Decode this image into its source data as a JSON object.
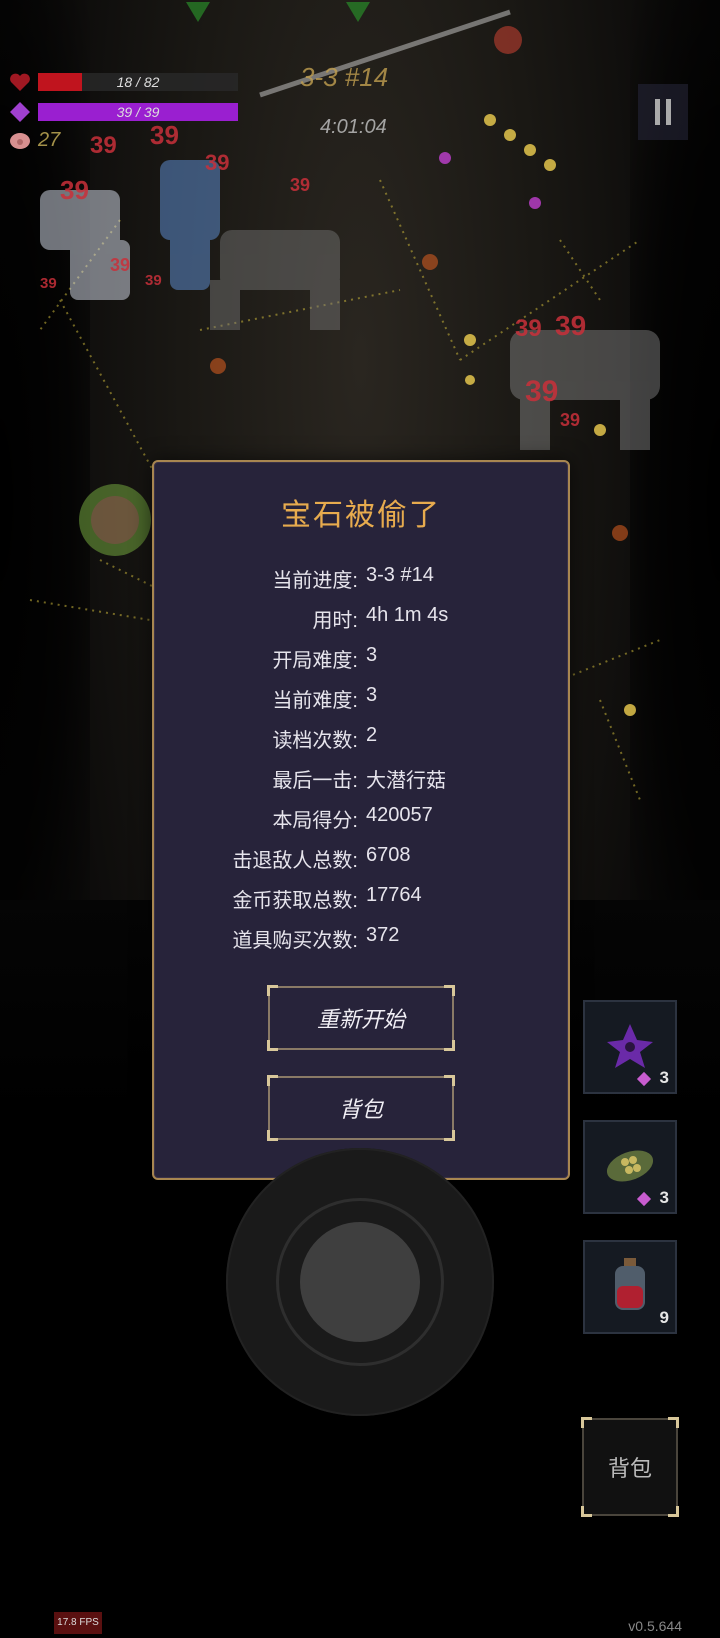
{
  "hud": {
    "hp_text": "18 / 82",
    "hp_fraction": 0.22,
    "mana_text": "39 / 39",
    "mana_fraction": 1.0,
    "gold_text": "27",
    "stage": "3-3 #14",
    "timer": "4:01:04",
    "icons": [
      "heart-icon",
      "gem-icon",
      "pig-icon",
      "pause-icon"
    ]
  },
  "damage_numbers": [
    "39",
    "39",
    "39",
    "39",
    "39",
    "39",
    "39",
    "39",
    "39",
    "39",
    "39",
    "39"
  ],
  "dialog": {
    "title": "宝石被偷了",
    "stats": [
      {
        "label": "当前进度:",
        "value": "3-3 #14"
      },
      {
        "label": "用时:",
        "value": "4h 1m 4s"
      },
      {
        "label": "开局难度:",
        "value": "3"
      },
      {
        "label": "当前难度:",
        "value": "3"
      },
      {
        "label": "读档次数:",
        "value": "2"
      },
      {
        "label": "最后一击:",
        "value": "大潜行菇"
      },
      {
        "label": "本局得分:",
        "value": "420057"
      },
      {
        "label": "击退敌人总数:",
        "value": "6708"
      },
      {
        "label": "金币获取总数:",
        "value": "17764"
      },
      {
        "label": "道具购买次数:",
        "value": "372"
      }
    ],
    "restart_label": "重新开始",
    "bag_label": "背包"
  },
  "items": [
    {
      "icon": "shuriken-icon",
      "count": "3",
      "cost_gem": true
    },
    {
      "icon": "seed-pod-icon",
      "count": "3",
      "cost_gem": true
    },
    {
      "icon": "potion-icon",
      "count": "9",
      "cost_gem": false
    }
  ],
  "bag_button_label": "背包",
  "fps": "17.8 FPS",
  "version": "v0.5.644",
  "colors": {
    "hp": "#c0141e",
    "mana": "#9a1fd0",
    "dialog_bg": "#27233a",
    "dialog_border": "#a88650",
    "title": "#e7ab4e"
  }
}
